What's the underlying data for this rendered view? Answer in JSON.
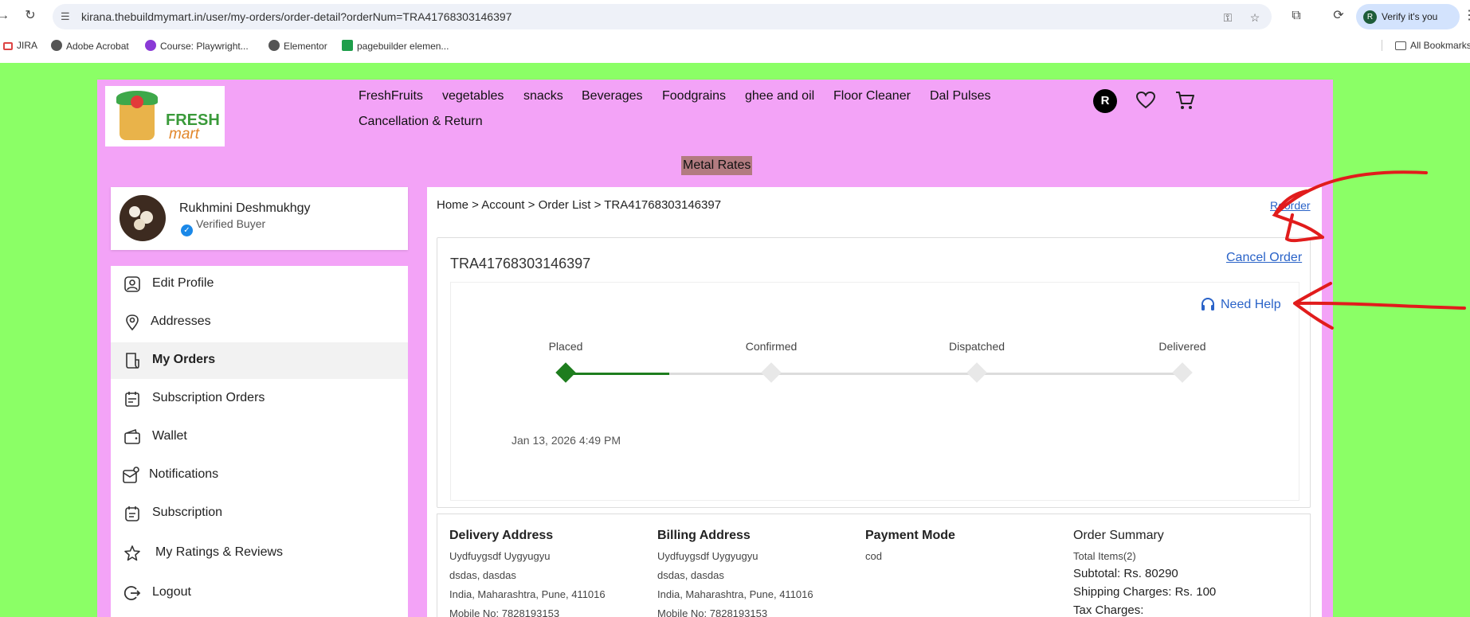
{
  "browser": {
    "url": "kirana.thebuildmymart.in/user/my-orders/order-detail?orderNum=TRA41768303146397",
    "profile_initial": "R",
    "verify_label": "Verify it's you",
    "bookmarks": [
      "JIRA",
      "Adobe Acrobat",
      "Course: Playwright...",
      "Elementor",
      "pagebuilder elemen..."
    ],
    "all_bookmarks": "All Bookmarks"
  },
  "header": {
    "logo_top": "FRESH",
    "logo_bottom": "mart",
    "menu": [
      "FreshFruits",
      "vegetables",
      "snacks",
      "Beverages",
      "Foodgrains",
      "ghee and oil",
      "Floor Cleaner",
      "Dal Pulses",
      "Cancellation & Return"
    ],
    "user_initial": "R",
    "metal_rates": "Metal Rates"
  },
  "user": {
    "name": "Rukhmini Deshmukhgy",
    "status": "Verified Buyer"
  },
  "sidebar": {
    "items": [
      {
        "label": "Edit Profile",
        "icon": "user-icon"
      },
      {
        "label": "Addresses",
        "icon": "location-icon"
      },
      {
        "label": "My Orders",
        "icon": "orders-icon"
      },
      {
        "label": "Subscription Orders",
        "icon": "calendar-icon"
      },
      {
        "label": "Wallet",
        "icon": "wallet-icon"
      },
      {
        "label": "Notifications",
        "icon": "notification-icon"
      },
      {
        "label": "Subscription",
        "icon": "subscription-icon"
      },
      {
        "label": "My Ratings & Reviews",
        "icon": "star-icon"
      },
      {
        "label": "Logout",
        "icon": "logout-icon"
      }
    ],
    "active_index": 2
  },
  "order": {
    "breadcrumb": "Home > Account > Order List > TRA41768303146397",
    "reorder": "Reorder",
    "number": "TRA41768303146397",
    "cancel": "Cancel Order",
    "need_help": "Need Help",
    "stages": [
      "Placed",
      "Confirmed",
      "Dispatched",
      "Delivered"
    ],
    "completed_stages": 1,
    "placed_date": "Jan 13, 2026 4:49 PM",
    "delivery": {
      "title": "Delivery Address",
      "name": "Uydfuygsdf Uygyugyu",
      "line1": "dsdas, dasdas",
      "line2": "India, Maharashtra, Pune, 411016",
      "mobile": "Mobile No: 7828193153"
    },
    "billing": {
      "title": "Billing Address",
      "name": "Uydfuygsdf Uygyugyu",
      "line1": "dsdas, dasdas",
      "line2": "India, Maharashtra, Pune, 411016",
      "mobile": "Mobile No: 7828193153"
    },
    "payment": {
      "title": "Payment Mode",
      "value": "cod"
    },
    "summary": {
      "title": "Order Summary",
      "items": "Total Items(2)",
      "subtotal": "Subtotal: Rs. 80290",
      "shipping": "Shipping Charges: Rs. 100",
      "tax": "Tax Charges:"
    }
  },
  "colors": {
    "page_bg": "#8bff66",
    "panel_bg": "#f3a3f7",
    "link": "#2a63c8",
    "track_done": "#1e7d1e",
    "annotation": "#e11c1c"
  }
}
